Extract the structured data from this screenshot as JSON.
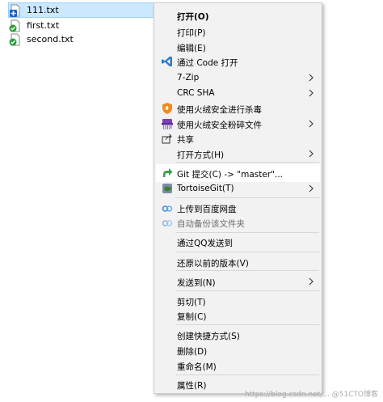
{
  "files": [
    {
      "name": "111.txt",
      "icon": "txt-plus-icon",
      "selected": true
    },
    {
      "name": "first.txt",
      "icon": "txt-git-check-icon",
      "selected": false
    },
    {
      "name": "second.txt",
      "icon": "txt-git-check-icon",
      "selected": false
    }
  ],
  "menu": {
    "open": "打开(O)",
    "print": "打印(P)",
    "edit": "编辑(E)",
    "open_with_code": "通过 Code 打开",
    "seven_zip": "7-Zip",
    "crc_sha": "CRC SHA",
    "huorong_scan": "使用火绒安全进行杀毒",
    "huorong_shred": "使用火绒安全粉碎文件",
    "share": "共享",
    "open_with": "打开方式(H)",
    "git_commit": "Git 提交(C) -> \"master\"...",
    "tortoisegit": "TortoiseGit(T)",
    "upload_baidu": "上传到百度网盘",
    "auto_backup": "自动备份该文件夹",
    "send_qq": "通过QQ发送到",
    "restore_versions": "还原以前的版本(V)",
    "send_to": "发送到(N)",
    "cut": "剪切(T)",
    "copy": "复制(C)",
    "create_shortcut": "创建快捷方式(S)",
    "delete": "删除(D)",
    "rename": "重命名(M)",
    "properties": "属性(R)"
  },
  "watermark": "https://blog.csdn.net/... @51CTO博客",
  "colors": {
    "selection_bg": "#cce8ff",
    "selection_border": "#99d1ff",
    "menu_bg": "#f2f2f2",
    "vscode_blue": "#2b7acb",
    "git_green": "#3aa04a",
    "huorong_orange": "#f08a1c",
    "huorong_purple": "#7a3fb8",
    "baidu_blue": "#3b8fe0"
  }
}
